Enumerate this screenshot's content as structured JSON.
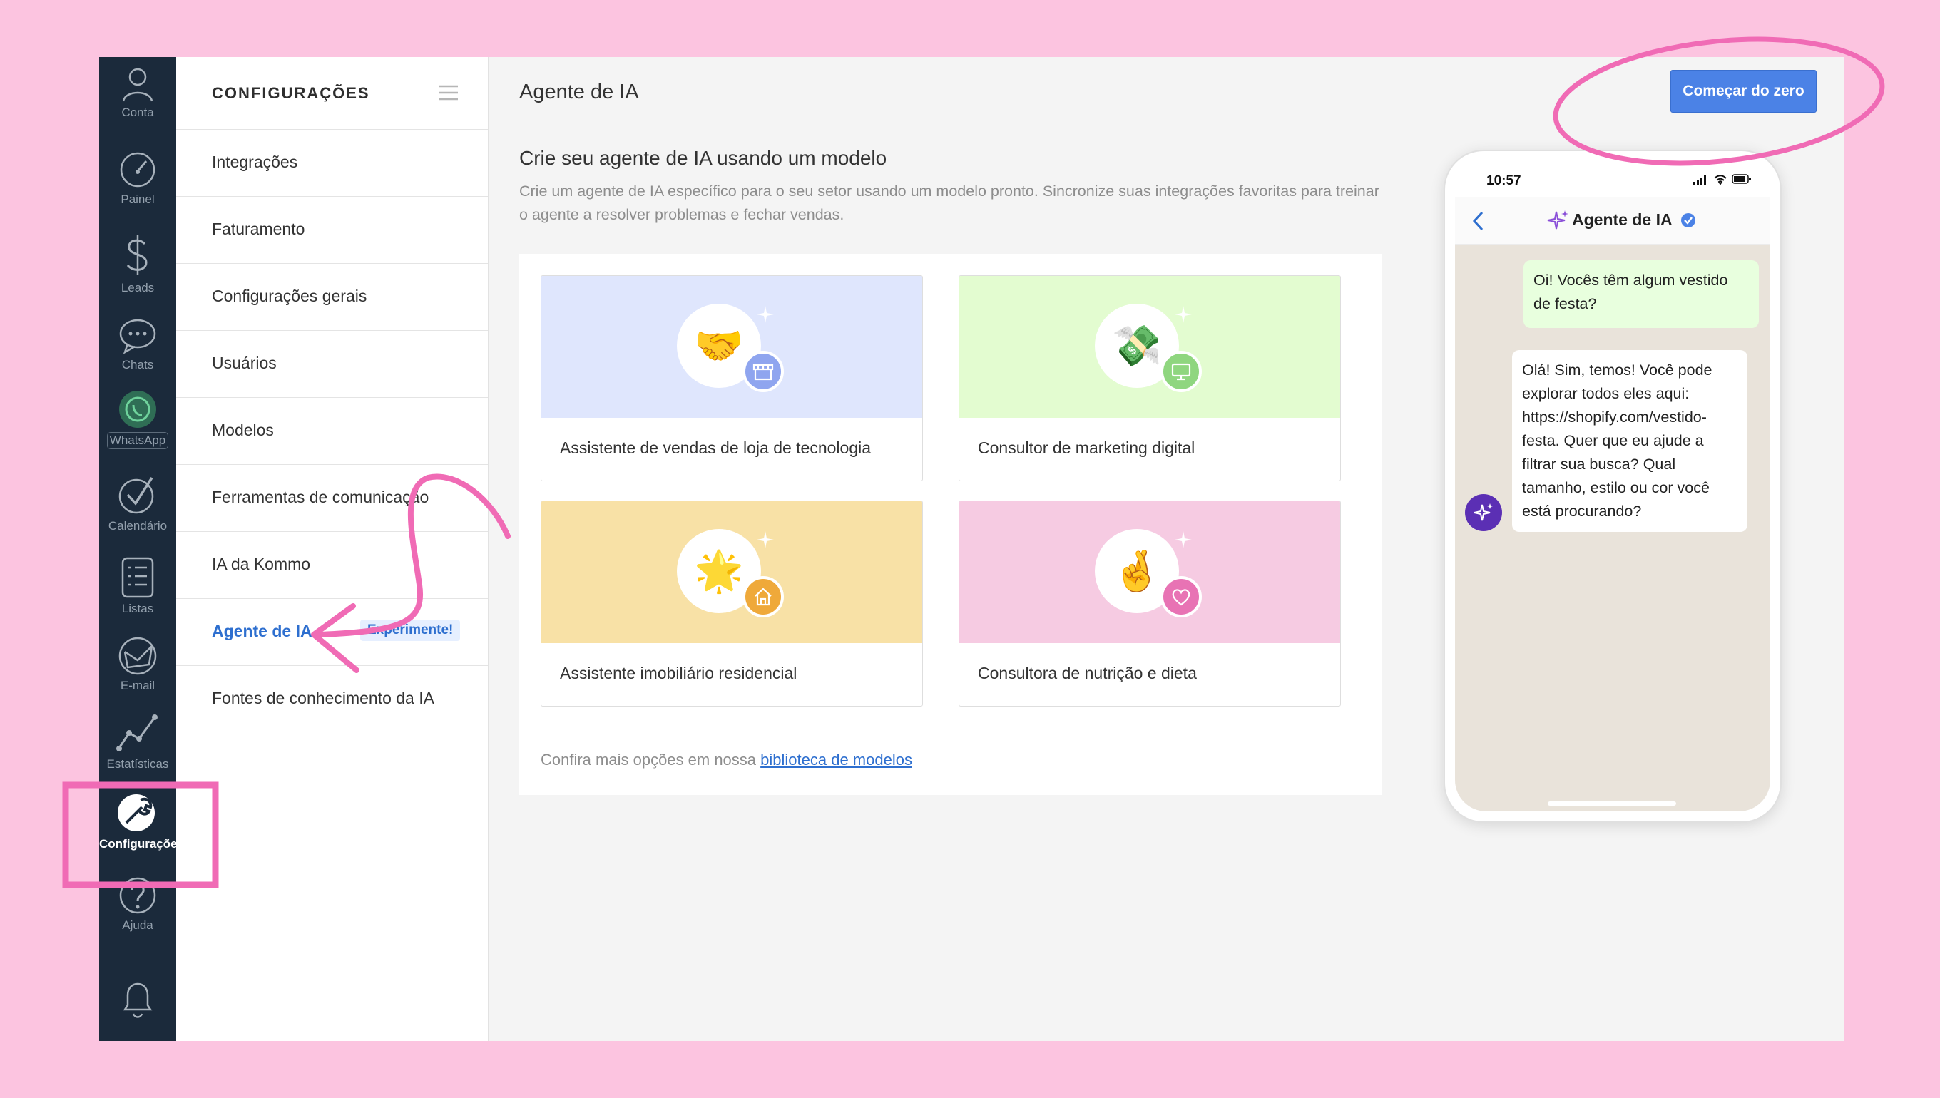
{
  "sidebar": {
    "items": [
      {
        "label": "Conta",
        "icon": "user-icon"
      },
      {
        "label": "Painel",
        "icon": "speedometer-icon"
      },
      {
        "label": "Leads",
        "icon": "dollar-icon"
      },
      {
        "label": "Chats",
        "icon": "chat-icon"
      },
      {
        "label": "WhatsApp",
        "icon": "whatsapp-icon"
      },
      {
        "label": "Calendário",
        "icon": "checkmark-icon"
      },
      {
        "label": "Listas",
        "icon": "list-icon"
      },
      {
        "label": "E-mail",
        "icon": "mail-icon"
      },
      {
        "label": "Estatísticas",
        "icon": "stats-icon"
      },
      {
        "label": "Configurações",
        "icon": "wrench-icon",
        "active": true
      },
      {
        "label": "Ajuda",
        "icon": "help-icon"
      },
      {
        "label": "",
        "icon": "bell-icon"
      }
    ]
  },
  "menu": {
    "title": "CONFIGURAÇÕES",
    "items": [
      {
        "label": "Integrações"
      },
      {
        "label": "Faturamento"
      },
      {
        "label": "Configurações gerais"
      },
      {
        "label": "Usuários"
      },
      {
        "label": "Modelos"
      },
      {
        "label": "Ferramentas de comunicação"
      },
      {
        "label": "IA da Kommo"
      },
      {
        "label": "Agente de IA",
        "badge": "Experimente!",
        "active": true
      },
      {
        "label": "Fontes de conhecimento da IA"
      }
    ]
  },
  "main": {
    "title": "Agente de IA",
    "start_button": "Começar do zero",
    "section_title": "Crie seu agente de IA usando um modelo",
    "section_desc": "Crie um agente de IA específico para o seu setor usando um modelo pronto. Sincronize suas integrações favoritas para treinar o agente a resolver problemas e fechar vendas.",
    "cards": [
      {
        "title": "Assistente de vendas de loja de tecnologia",
        "bg": "#dfe6fd",
        "badge_color": "#8fa5ef",
        "emoji": "🤝",
        "badge_icon": "store-icon"
      },
      {
        "title": "Consultor de marketing digital",
        "bg": "#e3fcd0",
        "badge_color": "#8fd67f",
        "emoji": "💸",
        "badge_icon": "monitor-icon"
      },
      {
        "title": "Assistente imobiliário residencial",
        "bg": "#f8e1a6",
        "badge_color": "#efa93a",
        "emoji": "🌟",
        "badge_icon": "house-icon"
      },
      {
        "title": "Consultora de nutrição e dieta",
        "bg": "#f6cbe2",
        "badge_color": "#e873b4",
        "emoji": "🤞",
        "badge_icon": "heart-icon"
      }
    ],
    "more_prefix": "Confira mais opções em nossa ",
    "more_link": "biblioteca de modelos"
  },
  "phone": {
    "time": "10:57",
    "chat_title": "Agente de IA",
    "messages": [
      {
        "from": "user",
        "text": "Oi! Vocês têm algum vestido de festa?"
      },
      {
        "from": "bot",
        "text": "Olá! Sim, temos! Você pode explorar todos eles aqui: https://shopify.com/vestido-festa. Quer que eu ajude a filtrar sua busca? Qual tamanho, estilo ou cor você está procurando?"
      }
    ]
  },
  "colors": {
    "accent": "#4b82e6",
    "rail": "#1b2a3b",
    "annotation": "#f06bb5",
    "page_bg": "#fcc4e0"
  }
}
